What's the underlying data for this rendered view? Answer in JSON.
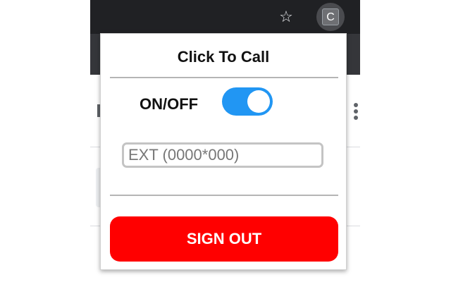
{
  "browser": {
    "star_icon": "star-outline-icon",
    "extension_letter": "C",
    "colors": {
      "titlebar": "#202124",
      "toolbar": "#35363a"
    }
  },
  "popup": {
    "title": "Click To Call",
    "toggle": {
      "label": "ON/OFF",
      "state": "on",
      "color": "#2196f3"
    },
    "extension_input": {
      "placeholder": "EXT (0000*000)",
      "value": ""
    },
    "sign_out_label": "SIGN OUT",
    "colors": {
      "sign_out_bg": "#ff0000"
    }
  }
}
